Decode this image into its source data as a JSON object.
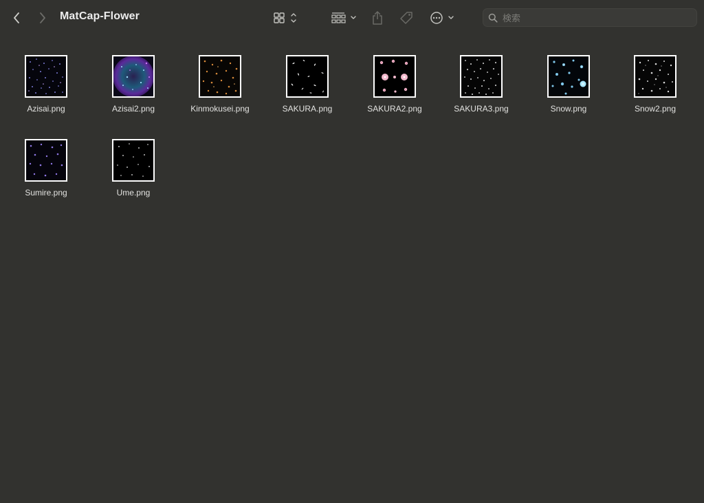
{
  "window": {
    "title": "MatCap-Flower"
  },
  "toolbar": {
    "back_icon": "chevron-left-icon",
    "forward_icon": "chevron-right-icon",
    "view_icon": "icon-grid-view-icon",
    "group_icon": "group-by-icon",
    "share_icon": "share-icon",
    "tag_icon": "tag-icon",
    "more_icon": "ellipsis-circle-icon"
  },
  "search": {
    "placeholder": "検索"
  },
  "files": [
    {
      "name": "Azisai.png"
    },
    {
      "name": "Azisai2.png"
    },
    {
      "name": "Kinmokusei.png"
    },
    {
      "name": "SAKURA.png"
    },
    {
      "name": "SAKURA2.png"
    },
    {
      "name": "SAKURA3.png"
    },
    {
      "name": "Snow.png"
    },
    {
      "name": "Snow2.png"
    },
    {
      "name": "Sumire.png"
    },
    {
      "name": "Ume.png"
    }
  ],
  "colors": {
    "background": "#32322f",
    "text": "#e2e2e0",
    "thumb_border": "#ffffff"
  }
}
